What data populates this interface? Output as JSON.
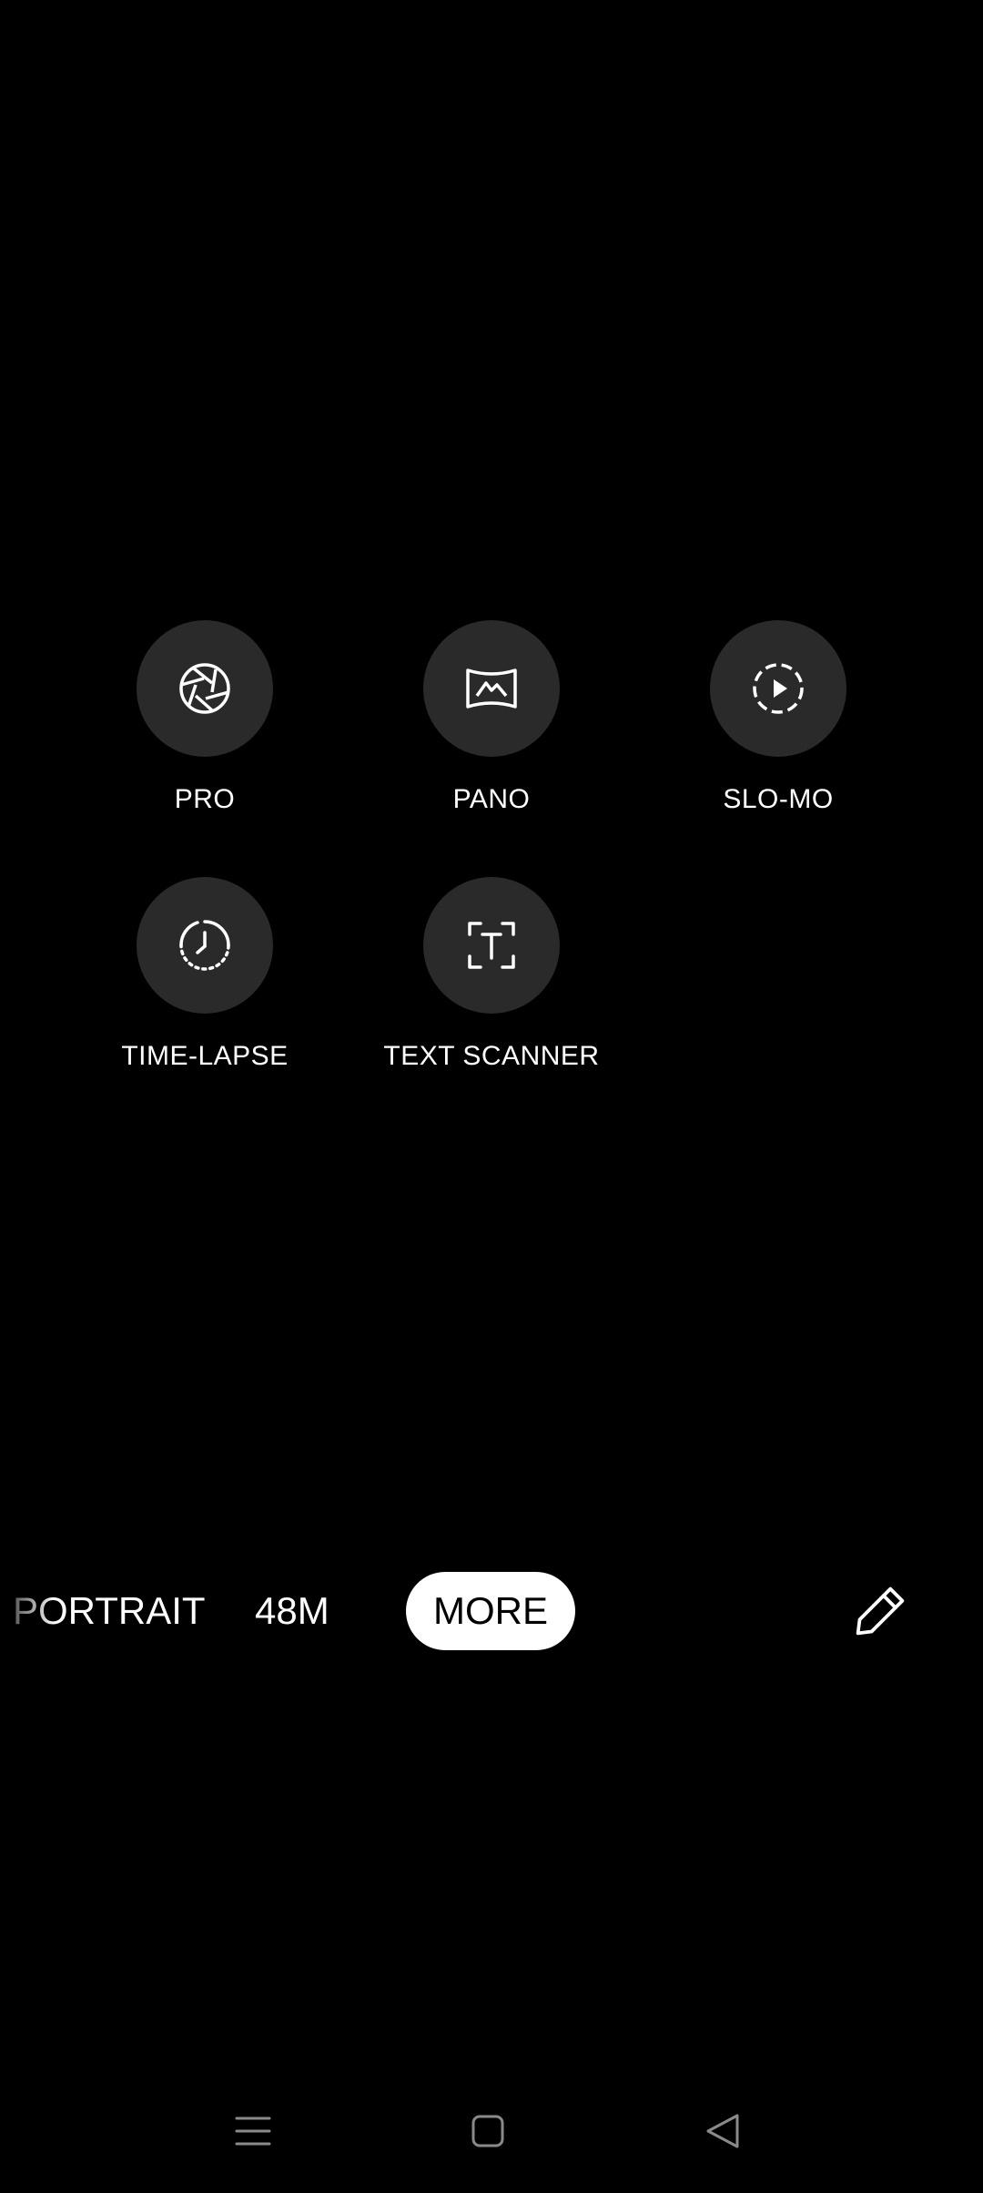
{
  "modes": [
    {
      "label": "PRO",
      "icon": "aperture-icon"
    },
    {
      "label": "PANO",
      "icon": "panorama-icon"
    },
    {
      "label": "SLO-MO",
      "icon": "slow-motion-icon"
    },
    {
      "label": "TIME-LAPSE",
      "icon": "time-lapse-icon"
    },
    {
      "label": "TEXT SCANNER",
      "icon": "text-scanner-icon"
    }
  ],
  "mode_bar": {
    "portrait": "PORTRAIT",
    "megapixel": "48M",
    "more": "MORE",
    "edit_icon": "pencil-icon"
  },
  "nav": {
    "recents_icon": "menu-icon",
    "home_icon": "home-square-icon",
    "back_icon": "back-triangle-icon"
  },
  "colors": {
    "background": "#000000",
    "tile": "#2a2a2a",
    "text": "#ffffff",
    "selected_pill": "#ffffff",
    "nav_icons": "#8a8a8a"
  }
}
